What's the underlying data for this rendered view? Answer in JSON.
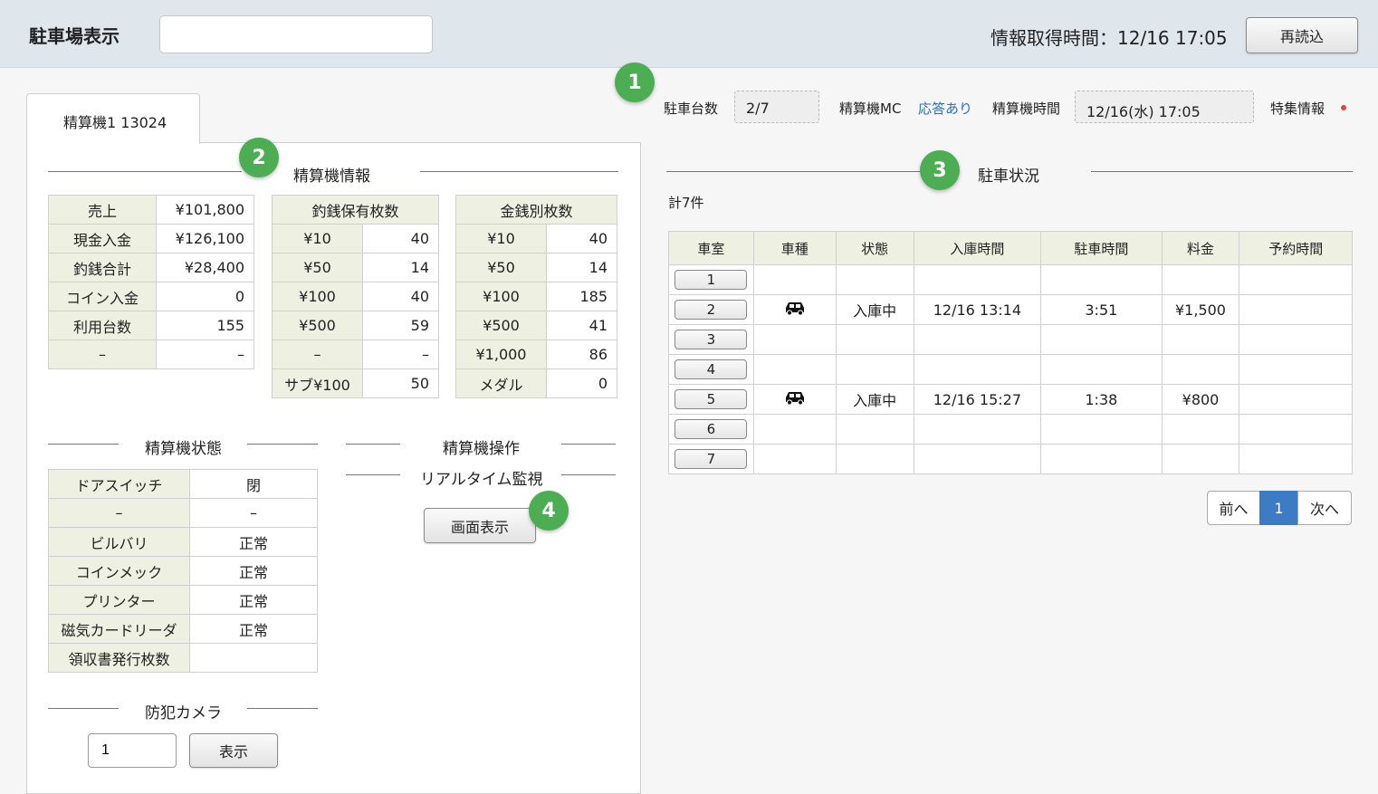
{
  "header": {
    "title": "駐車場表示",
    "search_value": "",
    "fetch_time": "情報取得時間：12/16 17:05",
    "reload_label": "再読込"
  },
  "badges": [
    "1",
    "2",
    "3",
    "4"
  ],
  "tab_label": "精算機1 13024",
  "info_bar": {
    "parking_count_label": "駐車台数",
    "parking_count": "2/7",
    "mc_label": "精算機MC",
    "mc_status": "応答あり",
    "time_label": "精算機時間",
    "time_value": "12/16(水) 17:05",
    "special_label": "特集情報"
  },
  "machine_info": {
    "section_title": "精算機情報",
    "summary": [
      {
        "label": "売上",
        "value": "¥101,800"
      },
      {
        "label": "現金入金",
        "value": "¥126,100"
      },
      {
        "label": "釣銭合計",
        "value": "¥28,400"
      },
      {
        "label": "コイン入金",
        "value": "0"
      },
      {
        "label": "利用台数",
        "value": "155"
      },
      {
        "label": "–",
        "value": "–"
      }
    ],
    "change_title": "釣銭保有枚数",
    "change": [
      {
        "label": "¥10",
        "value": "40"
      },
      {
        "label": "¥50",
        "value": "14"
      },
      {
        "label": "¥100",
        "value": "40"
      },
      {
        "label": "¥500",
        "value": "59"
      },
      {
        "label": "–",
        "value": "–"
      },
      {
        "label": "サブ¥100",
        "value": "50"
      }
    ],
    "money_title": "金銭別枚数",
    "money": [
      {
        "label": "¥10",
        "value": "40"
      },
      {
        "label": "¥50",
        "value": "14"
      },
      {
        "label": "¥100",
        "value": "185"
      },
      {
        "label": "¥500",
        "value": "41"
      },
      {
        "label": "¥1,000",
        "value": "86"
      },
      {
        "label": "メダル",
        "value": "0"
      }
    ]
  },
  "machine_state": {
    "section_title": "精算機状態",
    "rows": [
      {
        "label": "ドアスイッチ",
        "value": "閉"
      },
      {
        "label": "–",
        "value": "–"
      },
      {
        "label": "ビルバリ",
        "value": "正常"
      },
      {
        "label": "コインメック",
        "value": "正常"
      },
      {
        "label": "プリンター",
        "value": "正常"
      },
      {
        "label": "磁気カードリーダ",
        "value": "正常"
      },
      {
        "label": "領収書発行枚数",
        "value": ""
      }
    ]
  },
  "operation": {
    "section_title": "精算機操作",
    "monitor_title": "リアルタイム監視",
    "screen_button": "画面表示"
  },
  "camera": {
    "section_title": "防犯カメラ",
    "input_value": "1",
    "show_button": "表示"
  },
  "parking": {
    "section_title": "駐車状況",
    "total": "計7件",
    "columns": [
      "車室",
      "車種",
      "状態",
      "入庫時間",
      "駐車時間",
      "料金",
      "予約時間"
    ],
    "rows": [
      {
        "room": "1",
        "car": false,
        "status": "",
        "in_time": "",
        "duration": "",
        "fee": "",
        "reserve": ""
      },
      {
        "room": "2",
        "car": true,
        "status": "入庫中",
        "in_time": "12/16 13:14",
        "duration": "3:51",
        "fee": "¥1,500",
        "reserve": ""
      },
      {
        "room": "3",
        "car": false,
        "status": "",
        "in_time": "",
        "duration": "",
        "fee": "",
        "reserve": ""
      },
      {
        "room": "4",
        "car": false,
        "status": "",
        "in_time": "",
        "duration": "",
        "fee": "",
        "reserve": ""
      },
      {
        "room": "5",
        "car": true,
        "status": "入庫中",
        "in_time": "12/16 15:27",
        "duration": "1:38",
        "fee": "¥800",
        "reserve": ""
      },
      {
        "room": "6",
        "car": false,
        "status": "",
        "in_time": "",
        "duration": "",
        "fee": "",
        "reserve": ""
      },
      {
        "room": "7",
        "car": false,
        "status": "",
        "in_time": "",
        "duration": "",
        "fee": "",
        "reserve": ""
      }
    ]
  },
  "pagination": {
    "prev": "前へ",
    "current": "1",
    "next": "次へ"
  },
  "colors": {
    "badge": "#4cad52",
    "link": "#2f6fb3",
    "active_page": "#3d7cc4",
    "alert_dot": "#e0463b"
  }
}
